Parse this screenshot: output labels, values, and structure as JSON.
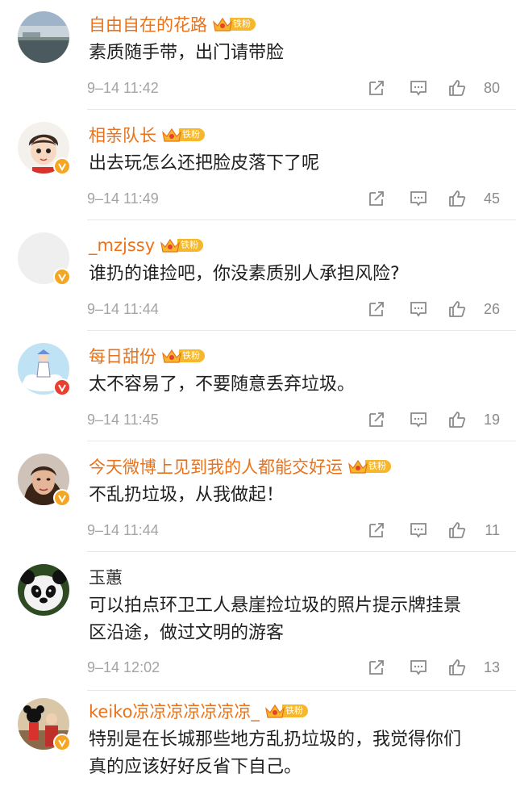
{
  "comments": [
    {
      "name": "自由自在的花路",
      "fan_tag": "铁粉",
      "text": "素质随手带，出门请带脸",
      "time": "9–14 11:42",
      "likes": "80",
      "avatar": "landscape",
      "verified": ""
    },
    {
      "name": "相亲队长",
      "fan_tag": "铁粉",
      "text": "出去玩怎么还把脸皮落下了呢",
      "time": "9–14 11:49",
      "likes": "45",
      "avatar": "cartoon-boy",
      "verified": "gold"
    },
    {
      "name": "_mzjssy",
      "fan_tag": "铁粉",
      "text": "谁扔的谁捡吧，你没素质别人承担风险?",
      "time": "9–14 11:44",
      "likes": "26",
      "avatar": "blank",
      "verified": "gold"
    },
    {
      "name": "每日甜份",
      "fan_tag": "铁粉",
      "text": "太不容易了，不要随意丢弃垃圾。",
      "time": "9–14 11:45",
      "likes": "19",
      "avatar": "cloud-girl",
      "verified": "red"
    },
    {
      "name": "今天微博上见到我的人都能交好运",
      "fan_tag": "铁粉",
      "text": "不乱扔垃圾，从我做起！",
      "time": "9–14 11:44",
      "likes": "11",
      "avatar": "woman",
      "verified": "gold"
    },
    {
      "name": "玉蕙",
      "fan_tag": "",
      "text_lines": [
        "可以拍点环卫工人悬崖捡垃圾的照片提示牌挂景",
        "区沿途，做过文明的游客"
      ],
      "time": "9–14 12:02",
      "likes": "13",
      "avatar": "panda",
      "verified": ""
    },
    {
      "name": "keiko凉凉凉凉凉凉凉_",
      "fan_tag": "铁粉",
      "text_lines": [
        "特别是在长城那些地方乱扔垃圾的，我觉得你们",
        "真的应该好好反省下自己。"
      ],
      "time": "",
      "likes": "",
      "avatar": "mickey",
      "verified": "gold"
    }
  ],
  "colors": {
    "name": "#e8731c",
    "fan_tag": "#f6b72a",
    "meta": "#a4a4a4",
    "verified_gold": "#f5a623",
    "verified_red": "#e8402f"
  },
  "icons": {
    "share": "share-icon",
    "reply": "comment-icon",
    "like": "thumbs-up-icon"
  }
}
